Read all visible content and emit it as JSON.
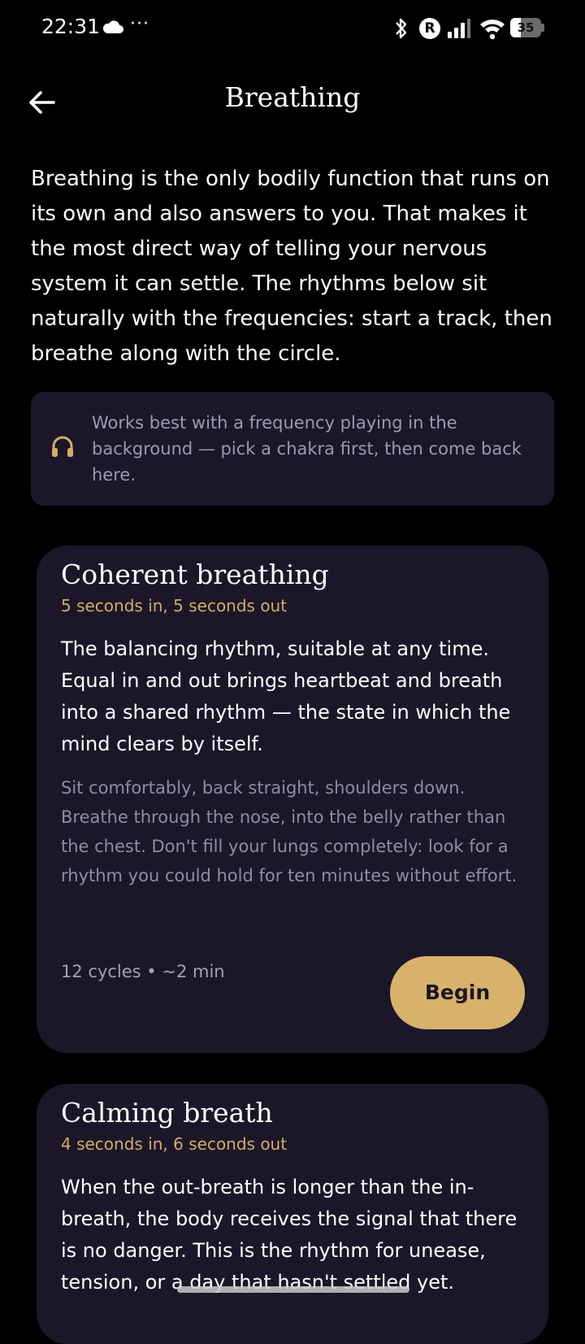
{
  "status_bar": {
    "time": "22:31",
    "dots": "···",
    "carrier_badge": "R",
    "battery": "35",
    "icons": [
      "cloud-icon",
      "bluetooth-icon",
      "signal-icon",
      "wifi-icon",
      "battery-icon"
    ]
  },
  "header": {
    "title": "Breathing",
    "back_icon": "arrow-left-icon"
  },
  "intro": "Breathing is the only bodily function that runs on its own and also answers to you. That makes it the most direct way of telling your nervous system it can settle. The rhythms below sit naturally with the frequencies: start a track, then breathe along with the circle.",
  "hint": {
    "icon": "headphones-icon",
    "text": "Works best with a frequency playing in the background — pick a chakra first, then come back here."
  },
  "cards": [
    {
      "title": "Coherent breathing",
      "subtitle": "5 seconds in, 5 seconds out",
      "description": "The balancing rhythm, suitable at any time. Equal in and out brings heartbeat and breath into a shared rhythm — the state in which the mind clears by itself.",
      "instructions": "Sit comfortably, back straight, shoulders down. Breathe through the nose, into the belly rather than the chest. Don't fill your lungs completely: look for a rhythm you could hold for ten minutes without effort.",
      "meta": "12 cycles • ~2 min",
      "button": "Begin"
    },
    {
      "title": "Calming breath",
      "subtitle": "4 seconds in, 6 seconds out",
      "description": "When the out-breath is longer than the in-breath, the body receives the signal that there is no danger. This is the rhythm for unease, tension, or a day that hasn't settled yet."
    }
  ],
  "colors": {
    "background": "#000000",
    "card": "#1b1729",
    "accent": "#d4ad63",
    "button": "#d8b26b"
  }
}
